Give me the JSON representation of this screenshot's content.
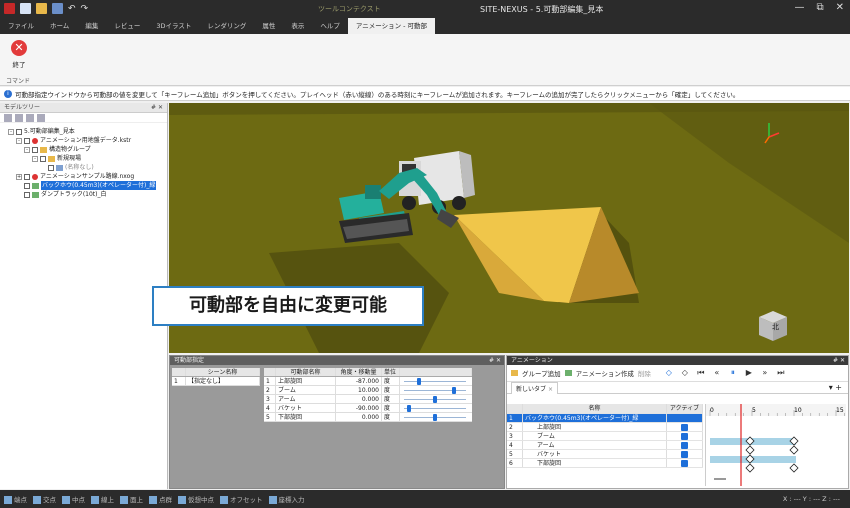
{
  "window": {
    "title": "SITE-NEXUS - 5.可動部編集_見本",
    "context_tab_group": "ツールコンテクスト",
    "controls": [
      "—",
      "⧉",
      "✕"
    ]
  },
  "menu": {
    "tabs": [
      "ファイル",
      "ホーム",
      "編集",
      "レビュー",
      "3Dイラスト",
      "レンダリング",
      "属性",
      "表示",
      "ヘルプ",
      "アニメーション - 可動部"
    ],
    "active_index": 9
  },
  "ribbon": {
    "end_button": "終了",
    "group_label": "コマンド"
  },
  "info": {
    "message": "可動部指定ウインドウから可動部の値を変更して「キーフレーム追加」ボタンを押してください。プレイヘッド（赤い縦線）のある時刻にキーフレームが追加されます。キーフレームの追加が完了したらクリックメニューから「確定」してください。"
  },
  "model_tree": {
    "title": "モデルツリー",
    "pin": "# ✕",
    "items": [
      {
        "label": "5.可動部編集_見本",
        "level": 0
      },
      {
        "label": "アニメーション用地盤データ.kstr",
        "level": 1
      },
      {
        "label": "構造物グループ",
        "level": 2
      },
      {
        "label": "新規現場",
        "level": 3
      },
      {
        "label": "(名称なし)",
        "level": 4
      },
      {
        "label": "アニメーションサンプル路線.nxog",
        "level": 1
      },
      {
        "label": "バックホウ(0.45m3)(オペレーター付)_緑",
        "level": 1,
        "selected": true
      },
      {
        "label": "ダンプトラック(10t)_白",
        "level": 1
      }
    ]
  },
  "callout": {
    "text": "可動部を自由に変更可能"
  },
  "viewport": {
    "compass": "北"
  },
  "movable_panel": {
    "title": "可動部指定",
    "pin": "# ✕",
    "scene_headers": [
      "",
      "シーン名称"
    ],
    "scenes": [
      {
        "no": "1",
        "name": "【指定なし】"
      }
    ],
    "part_headers": [
      "",
      "可動部名称",
      "角度・移動量",
      "単位"
    ],
    "parts": [
      {
        "no": "1",
        "name": "上部旋回",
        "value": "-87.000",
        "unit": "度",
        "slider": 0.22
      },
      {
        "no": "2",
        "name": "ブーム",
        "value": "10.000",
        "unit": "度",
        "slider": 0.82
      },
      {
        "no": "3",
        "name": "アーム",
        "value": "0.000",
        "unit": "度",
        "slider": 0.5
      },
      {
        "no": "4",
        "name": "バケット",
        "value": "-90.000",
        "unit": "度",
        "slider": 0.05
      },
      {
        "no": "5",
        "name": "下部旋回",
        "value": "0.000",
        "unit": "度",
        "slider": 0.5
      }
    ]
  },
  "animation_panel": {
    "title": "アニメーション",
    "pin": "# ✕",
    "toolbar": {
      "add_group": "グループ追加",
      "create": "アニメーション作成",
      "delete": "削除"
    },
    "tab": "新しいタブ",
    "headers": [
      "",
      "名称",
      "アクティブ"
    ],
    "rows": [
      {
        "no": "1",
        "name": "バックホウ(0.45m3)(オペレーター付)_緑",
        "selected": true
      },
      {
        "no": "2",
        "name": "上部旋回"
      },
      {
        "no": "3",
        "name": "ブーム"
      },
      {
        "no": "4",
        "name": "アーム"
      },
      {
        "no": "5",
        "name": "バケット"
      },
      {
        "no": "6",
        "name": "下部旋回"
      }
    ],
    "ruler": [
      "0",
      "5",
      "10",
      "15"
    ]
  },
  "status": {
    "items": [
      "端点",
      "交点",
      "中点",
      "線上",
      "面上",
      "点群",
      "仮想中点",
      "オフセット",
      "座標入力"
    ],
    "coords": "X : ---   Y : ---   Z : ---"
  },
  "colors": {
    "accent": "#1e6fd9",
    "ground": "#6d6a12",
    "pit": "#f0c64a",
    "excavator": "#1f9f8e",
    "playhead": "#e02020",
    "keyframe_bar": "#a8d3e6"
  }
}
